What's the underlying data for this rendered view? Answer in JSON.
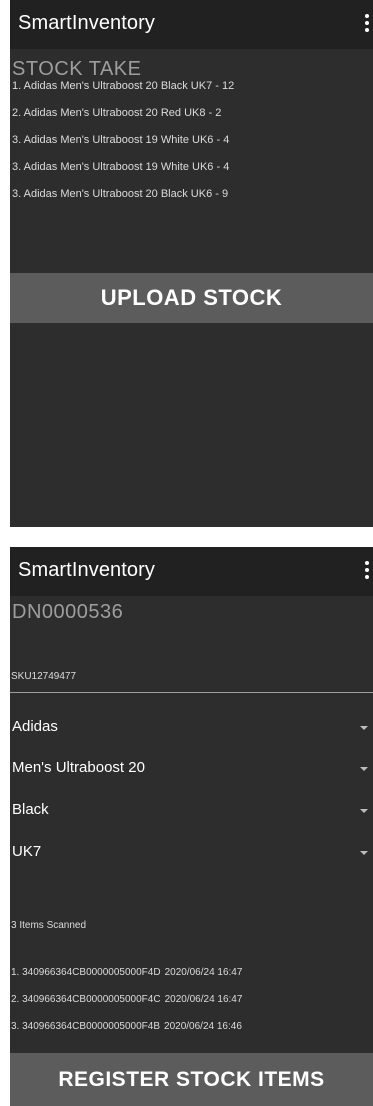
{
  "screen1": {
    "app_title": "SmartInventory",
    "section_title": "STOCK TAKE",
    "stock_items": [
      "1. Adidas Men's Ultraboost 20 Black UK7 - 12",
      "2. Adidas Men's Ultraboost 20 Red UK8 - 2",
      "3. Adidas Men's Ultraboost 19 White UK6 - 4",
      "3. Adidas Men's Ultraboost 19 White UK6 - 4",
      "3. Adidas Men's Ultraboost 20 Black UK6 - 9"
    ],
    "upload_button": "UPLOAD STOCK"
  },
  "screen2": {
    "app_title": "SmartInventory",
    "delivery_note": "DN0000536",
    "sku": "SKU12749477",
    "dropdowns": {
      "brand": "Adidas",
      "model": "Men's Ultraboost 20",
      "color": "Black",
      "size": "UK7"
    },
    "scanned_count": "3 Items Scanned",
    "scanned_items": [
      {
        "code": "1. 340966364CB0000005000F4D",
        "timestamp": "2020/06/24 16:47"
      },
      {
        "code": "2. 340966364CB0000005000F4C",
        "timestamp": "2020/06/24 16:47"
      },
      {
        "code": "3. 340966364CB0000005000F4B",
        "timestamp": "2020/06/24 16:46"
      }
    ],
    "register_button": "REGISTER STOCK ITEMS"
  },
  "colors": {
    "background": "#2d2d2d",
    "appbar": "#212121",
    "button": "#5c5c5c",
    "muted_text": "#9e9e9e"
  },
  "icons": {
    "overflow_menu": "more-vert-icon",
    "dropdown": "arrow-drop-down-icon"
  }
}
